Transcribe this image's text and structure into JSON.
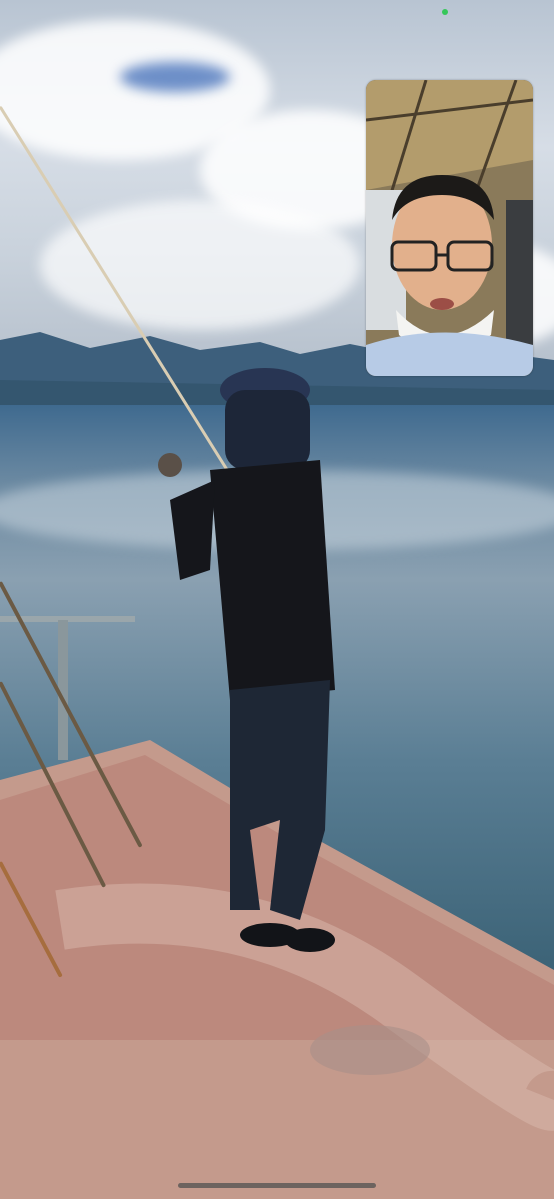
{
  "call": {
    "camera_indicator_color": "#35c759",
    "remote_video": "fishing-on-pier",
    "self_view": "caller-face"
  }
}
